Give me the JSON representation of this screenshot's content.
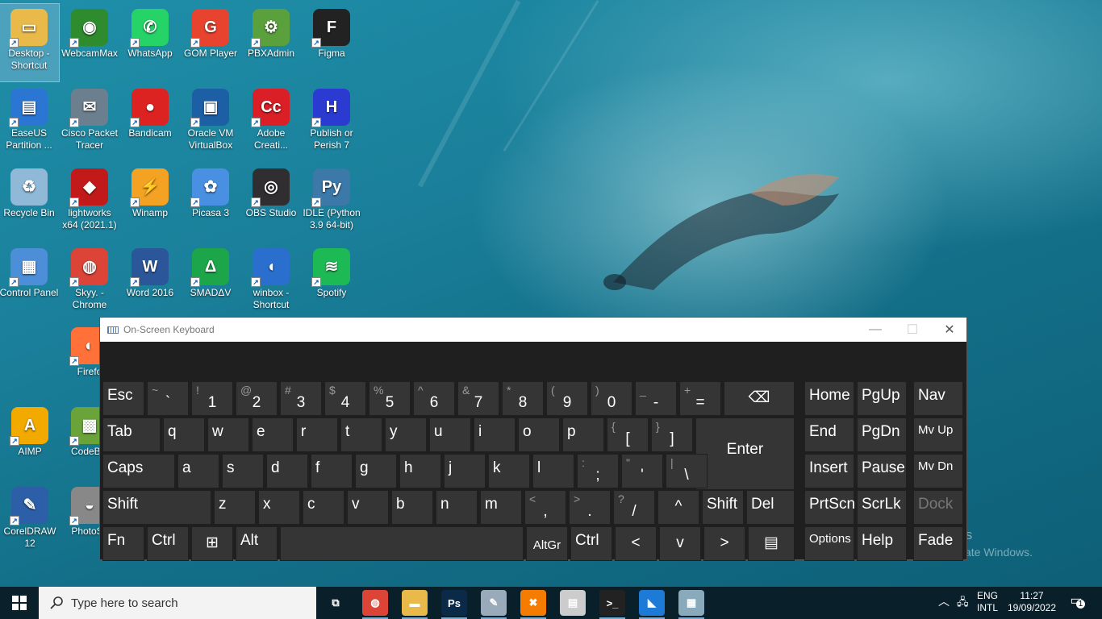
{
  "desktop": {
    "icons": [
      {
        "label": "Desktop - Shortcut",
        "color": "#e9b949",
        "glyph": "▭"
      },
      {
        "label": "WebcamMax",
        "color": "#2e8b2e",
        "glyph": "◉"
      },
      {
        "label": "WhatsApp",
        "color": "#25d366",
        "glyph": "✆"
      },
      {
        "label": "GOM Player",
        "color": "#e8432e",
        "glyph": "G"
      },
      {
        "label": "PBXAdmin",
        "color": "#5aa03c",
        "glyph": "⚙"
      },
      {
        "label": "Figma",
        "color": "#222",
        "glyph": "F"
      },
      {
        "label": "EaseUS Partition ...",
        "color": "#2a76d2",
        "glyph": "▤"
      },
      {
        "label": "Cisco Packet Tracer",
        "color": "#6b7f8e",
        "glyph": "✉"
      },
      {
        "label": "Bandicam",
        "color": "#d22",
        "glyph": "●"
      },
      {
        "label": "Oracle VM VirtualBox",
        "color": "#1d5fa5",
        "glyph": "▣"
      },
      {
        "label": "Adobe Creati...",
        "color": "#da1f26",
        "glyph": "Cc"
      },
      {
        "label": "Publish or Perish 7",
        "color": "#2b3bd1",
        "glyph": "H"
      },
      {
        "label": "Recycle Bin",
        "color": "#8fb9d6",
        "glyph": "♻"
      },
      {
        "label": "lightworks x64 (2021.1)",
        "color": "#c21a1a",
        "glyph": "◆"
      },
      {
        "label": "Winamp",
        "color": "#f3a223",
        "glyph": "⚡"
      },
      {
        "label": "Picasa 3",
        "color": "#4a90e2",
        "glyph": "✿"
      },
      {
        "label": "OBS Studio",
        "color": "#302e31",
        "glyph": "◎"
      },
      {
        "label": "IDLE (Python 3.9 64-bit)",
        "color": "#3c78a8",
        "glyph": "Py"
      },
      {
        "label": "Control Panel",
        "color": "#4d8ed8",
        "glyph": "▦"
      },
      {
        "label": "Skyy. - Chrome",
        "color": "#db4437",
        "glyph": "◍"
      },
      {
        "label": "Word 2016",
        "color": "#2b579a",
        "glyph": "W"
      },
      {
        "label": "SMADΔV",
        "color": "#1da54a",
        "glyph": "Δ"
      },
      {
        "label": "winbox - Shortcut",
        "color": "#2a6fce",
        "glyph": "◖"
      },
      {
        "label": "Spotify",
        "color": "#1db954",
        "glyph": "≋"
      },
      {
        "label": "Firefo",
        "color": "#ff7139",
        "glyph": "◐"
      },
      {
        "label": "AIMP",
        "color": "#f2a900",
        "glyph": "A"
      },
      {
        "label": "CodeBlo",
        "color": "#6aa33a",
        "glyph": "▩"
      },
      {
        "label": "CorelDRAW 12",
        "color": "#2d5fa8",
        "glyph": "✎"
      },
      {
        "label": "PhotoSc",
        "color": "#888",
        "glyph": "◒"
      }
    ]
  },
  "watermark": {
    "line1": "ows",
    "line2": "ctivate Windows."
  },
  "osk": {
    "title": "On-Screen Keyboard",
    "minimize": "—",
    "maximize": "☐",
    "close": "✕",
    "keys": {
      "esc": "Esc",
      "tilde_sub": "~",
      "tilde_main": "`",
      "n1_sub": "!",
      "n1": "1",
      "n2_sub": "@",
      "n2": "2",
      "n3_sub": "#",
      "n3": "3",
      "n4_sub": "$",
      "n4": "4",
      "n5_sub": "%",
      "n5": "5",
      "n6_sub": "^",
      "n6": "6",
      "n7_sub": "&",
      "n7": "7",
      "n8_sub": "*",
      "n8": "8",
      "n9_sub": "(",
      "n9": "9",
      "n0_sub": ")",
      "n0": "0",
      "minus_sub": "_",
      "minus": "-",
      "eq_sub": "+",
      "eq": "=",
      "backspace": "⌫",
      "home": "Home",
      "pgup": "PgUp",
      "nav": "Nav",
      "tab": "Tab",
      "q": "q",
      "w": "w",
      "e": "e",
      "r": "r",
      "t": "t",
      "y": "y",
      "u": "u",
      "i": "i",
      "o": "o",
      "p": "p",
      "lbr_sub": "{",
      "lbr": "[",
      "rbr_sub": "}",
      "rbr": "]",
      "enter": "Enter",
      "end": "End",
      "pgdn": "PgDn",
      "mvup": "Mv Up",
      "caps": "Caps",
      "a": "a",
      "s": "s",
      "d": "d",
      "f": "f",
      "g": "g",
      "h": "h",
      "j": "j",
      "k": "k",
      "l": "l",
      "semi_sub": ":",
      "semi": ";",
      "quote_sub": "\"",
      "quote": "'",
      "bs_sub": "|",
      "bslash": "\\",
      "insert": "Insert",
      "pause": "Pause",
      "mvdn": "Mv Dn",
      "shift": "Shift",
      "z": "z",
      "x": "x",
      "c": "c",
      "v": "v",
      "b": "b",
      "n": "n",
      "m": "m",
      "comma_sub": "<",
      "comma": ",",
      "dot_sub": ">",
      "dot": ".",
      "slash_sub": "?",
      "slash": "/",
      "up": "^",
      "rshift": "Shift",
      "del": "Del",
      "prtscn": "PrtScn",
      "scrlk": "ScrLk",
      "dock": "Dock",
      "fn": "Fn",
      "ctrl": "Ctrl",
      "win": "⊞",
      "alt": "Alt",
      "altgr": "AltGr",
      "rctrl": "Ctrl",
      "left": "<",
      "down": "v",
      "right": ">",
      "menu": "▤",
      "options": "Options",
      "help": "Help",
      "fade": "Fade"
    }
  },
  "taskbar": {
    "search_placeholder": "Type here to search",
    "apps": [
      {
        "name": "task-view",
        "glyph": "⧉",
        "color": "transparent"
      },
      {
        "name": "chrome",
        "glyph": "◍",
        "color": "#db4437"
      },
      {
        "name": "file-explorer",
        "glyph": "▬",
        "color": "#e9b949"
      },
      {
        "name": "photoshop",
        "glyph": "Ps",
        "color": "#0a2a48"
      },
      {
        "name": "notepad",
        "glyph": "✎",
        "color": "#9ab"
      },
      {
        "name": "xampp",
        "glyph": "✖",
        "color": "#f57c00"
      },
      {
        "name": "window-app",
        "glyph": "▤",
        "color": "#ccc"
      },
      {
        "name": "terminal",
        "glyph": ">_",
        "color": "#222"
      },
      {
        "name": "vscode",
        "glyph": "◣",
        "color": "#1d7ad6"
      },
      {
        "name": "network-app",
        "glyph": "▦",
        "color": "#8ab"
      }
    ],
    "lang_top": "ENG",
    "lang_bottom": "INTL",
    "time": "11:27",
    "date": "19/09/2022",
    "notif_count": "1"
  }
}
